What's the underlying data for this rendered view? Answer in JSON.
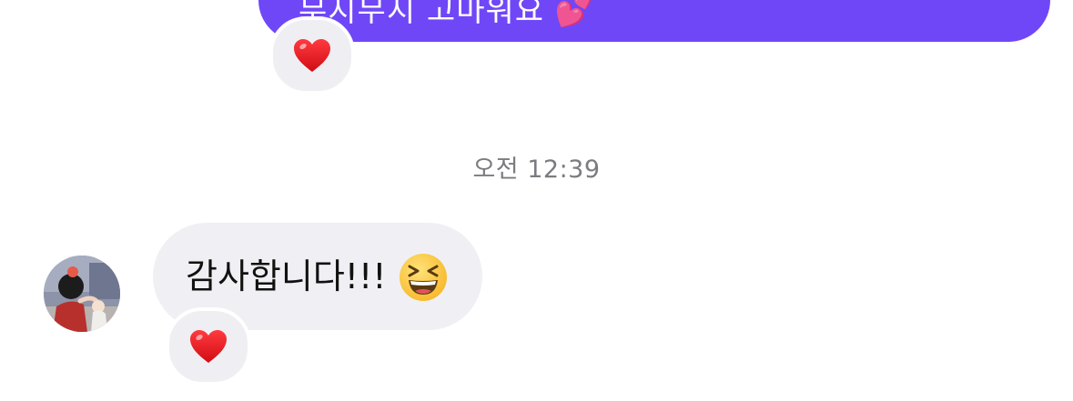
{
  "outgoing_message": {
    "text": "무지무지 고마워요 💕",
    "bubble_color": "#7047f7",
    "reaction": "heart-icon"
  },
  "timestamp": "오전 12:39",
  "incoming_message": {
    "text": "감사합니다!!!",
    "emoji": "grinning-squinting-face-icon",
    "bubble_color": "#f0f0f4",
    "reaction": "heart-icon"
  },
  "colors": {
    "heart": "#e8141b",
    "timestamp": "#7b7b80"
  }
}
